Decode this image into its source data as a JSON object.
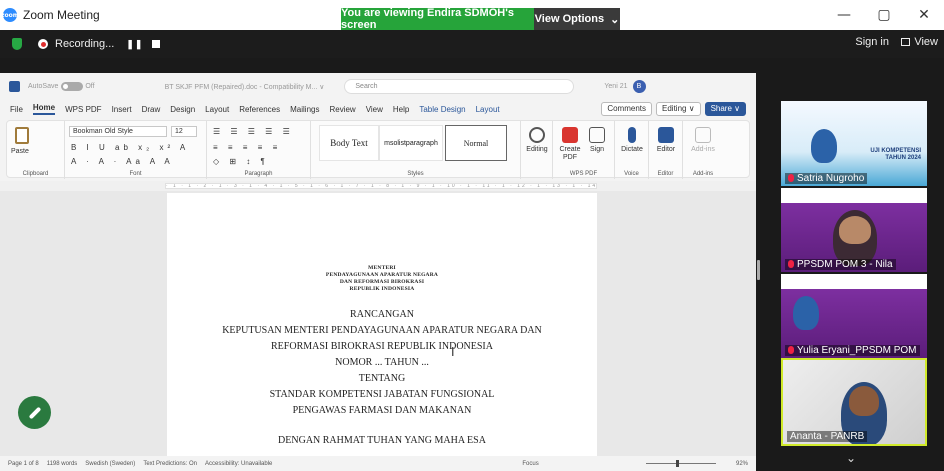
{
  "zoom": {
    "app_title": "Zoom Meeting",
    "share_banner": "You are viewing Endira SDMOH's screen",
    "view_options": "View Options",
    "view_options_chevron": "⌄",
    "window_controls": [
      "—",
      "▢",
      "✕"
    ],
    "recording_label": "Recording...",
    "sign_in": "Sign in",
    "view": "View",
    "logo_text": "zoom"
  },
  "word": {
    "autosave_label": "AutoSave",
    "autosave_state": "Off",
    "doc_title": "BT SKJF PFM (Repaired).doc - Compatibility M... ∨",
    "search_placeholder": "Search",
    "account_name": "Yeni 21",
    "account_initial": "B",
    "tabs": [
      "File",
      "Home",
      "WPS PDF",
      "Insert",
      "Draw",
      "Design",
      "Layout",
      "References",
      "Mailings",
      "Review",
      "View",
      "Help",
      "Table Design",
      "Layout"
    ],
    "active_tab": "Home",
    "comments": "Comments",
    "editing": "Editing ∨",
    "share": "Share ∨",
    "ribbon": {
      "clipboard": "Clipboard",
      "paste": "Paste",
      "font_name": "Bookman Old Style",
      "font_size": "12",
      "font_group": "Font",
      "paragraph_group": "Paragraph",
      "styles_group": "Styles",
      "styles": [
        "Body Text",
        "msolistparagraph",
        "Normal"
      ],
      "editing_btn": "Editing",
      "create_pdf": "Create PDF",
      "sign": "Sign",
      "wps_pdf_group": "WPS PDF",
      "dictate": "Dictate",
      "voice_group": "Voice",
      "editor": "Editor",
      "editor_group": "Editor",
      "addins": "Add-ins",
      "addins_group": "Add-ins"
    },
    "ruler_text": "· 1 · 1 · 2 · 1 · 3 · 1 · 4 · 1 · 5 · 1 · 6 · 1 · 7 · 1 · 8 · 1 · 9 · 1 · 10 · 1 · 11 · 1 · 12 · 1 · 13 · 1 · 14 · 1 · 15 · 1 · 16 · 1 ·",
    "document": {
      "header_lines": [
        "MENTERI",
        "PENDAYAGUNAAN APARATUR NEGARA",
        "DAN REFORMASI BIROKRASI",
        "REPUBLIK INDONESIA"
      ],
      "body_lines": [
        "RANCANGAN",
        "KEPUTUSAN MENTERI PENDAYAGUNAAN APARATUR NEGARA DAN",
        "REFORMASI BIROKRASI REPUBLIK INDONESIA",
        "NOMOR ... TAHUN ...",
        "TENTANG",
        "STANDAR KOMPETENSI JABATAN FUNGSIONAL",
        "PENGAWAS FARMASI DAN MAKANAN",
        "DENGAN RAHMAT TUHAN YANG MAHA ESA"
      ]
    },
    "status": {
      "page": "Page 1 of 8",
      "words": "1198 words",
      "language": "Swedish (Sweden)",
      "predictions": "Text Predictions: On",
      "accessibility": "Accessibility: Unavailable",
      "focus": "Focus",
      "zoom": "92%"
    }
  },
  "participants": [
    {
      "name": "Satria Nugroho",
      "muted": true,
      "active": false,
      "bg": "#e8f4fb",
      "banner_text": "UJI KOMPETENSI TAHUN 2024"
    },
    {
      "name": "PPSDM POM 3 - Nila",
      "muted": true,
      "active": false,
      "bg": "#7d2fa0",
      "banner_text": ""
    },
    {
      "name": "Yulia Eryani_PPSDM POM",
      "muted": true,
      "active": false,
      "bg": "#7d2fa0",
      "banner_text": ""
    },
    {
      "name": "Ananta - PANRB",
      "muted": false,
      "active": true,
      "bg": "#dcdcdc",
      "banner_text": ""
    }
  ],
  "colors": {
    "share_green": "#26a43a",
    "word_blue": "#2b579a",
    "active_speaker": "#d0ea2a"
  }
}
